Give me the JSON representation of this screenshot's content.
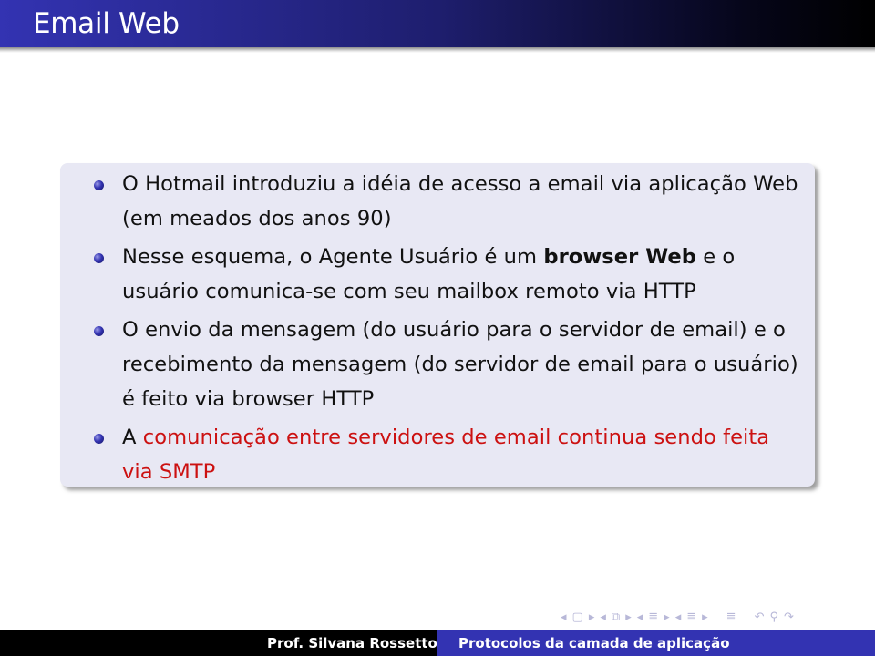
{
  "slide": {
    "title": "Email Web",
    "bullets": [
      {
        "parts": [
          {
            "text": "O Hotmail introduziu a idéia de acesso a email via aplicação Web (em meados dos anos 90)",
            "style": "normal"
          }
        ]
      },
      {
        "parts": [
          {
            "text": "Nesse esquema, o Agente Usuário é um ",
            "style": "normal"
          },
          {
            "text": "browser Web",
            "style": "bold"
          },
          {
            "text": " e o usuário comunica-se com seu mailbox remoto via HTTP",
            "style": "normal"
          }
        ]
      },
      {
        "parts": [
          {
            "text": "O envio da mensagem (do usuário para o servidor de email) e o recebimento da mensagem (do servidor de email para o usuário) é feito via browser HTTP",
            "style": "normal"
          }
        ]
      },
      {
        "parts": [
          {
            "text": "A ",
            "style": "normal"
          },
          {
            "text": "comunicação entre servidores de email continua sendo feita via SMTP",
            "style": "red"
          }
        ]
      }
    ]
  },
  "navigation": {
    "icons": [
      "arrow-left-icon",
      "frame-icon",
      "arrow-right-icon",
      "arrow-left-icon",
      "subsection-icon",
      "arrow-right-icon",
      "arrow-left-icon",
      "section-icon",
      "arrow-right-icon",
      "arrow-left-icon",
      "section-icon",
      "arrow-right-icon",
      "align-icon",
      "undo-icon",
      "search-icon",
      "redo-icon"
    ],
    "glyphs": [
      "◂",
      "▢",
      "▸",
      "◂",
      "⧉",
      "▸",
      "◂",
      "≣",
      "▸",
      "◂",
      "≣",
      "▸",
      "≣",
      "↶",
      "⚲",
      "↷"
    ]
  },
  "footer": {
    "author": "Prof. Silvana Rossetto",
    "topic": "Protocolos da camada de aplicação"
  },
  "colors": {
    "accent": "#3333b2",
    "highlight": "#cc1111",
    "block_bg": "#e8e8f4"
  }
}
